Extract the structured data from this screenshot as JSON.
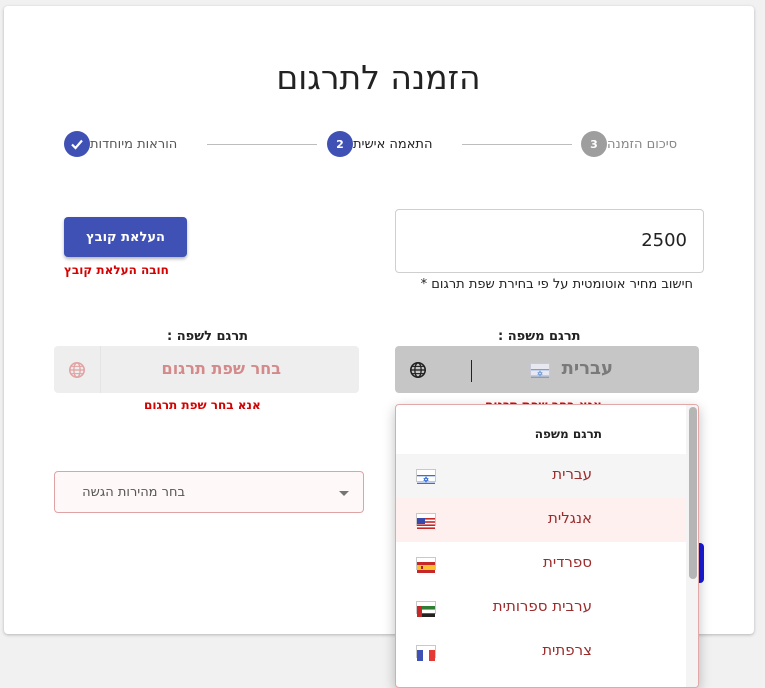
{
  "title": "הזמנה לתרגום",
  "stepper": {
    "steps": [
      {
        "label": "הוראות מיוחדות",
        "number": "",
        "state": "done"
      },
      {
        "label": "התאמה אישית",
        "number": "2",
        "state": "active"
      },
      {
        "label": "סיכום הזמנה",
        "number": "3",
        "state": "inactive"
      }
    ]
  },
  "price": {
    "value": "2500",
    "note": "חישוב מחיר אוטומטית על פי בחירת שפת תרגום *"
  },
  "upload": {
    "button_label": "העלאת קובץ",
    "error": "חובה העלאת קובץ"
  },
  "translate_from": {
    "label": "תרגם משפה :",
    "value": "עברית",
    "error_partial": "אנא בחר שפת תרגום"
  },
  "translate_to": {
    "label": "תרגם לשפה :",
    "placeholder": "בחר שפת תרגום",
    "error": "אנא בחר שפת תרגום"
  },
  "delivery_speed": {
    "placeholder": "בחר מהירות הגשה"
  },
  "dropdown": {
    "header": "תרגם משפה",
    "options": [
      {
        "label": "עברית",
        "flag": "israel-flag-icon"
      },
      {
        "label": "אנגלית",
        "flag": "usa-flag-icon"
      },
      {
        "label": "ספרדית",
        "flag": "spain-flag-icon"
      },
      {
        "label": "ערבית ספרותית",
        "flag": "uae-flag-icon"
      },
      {
        "label": "צרפתית",
        "flag": "france-flag-icon"
      }
    ]
  },
  "colors": {
    "primary": "#3f51b5",
    "completed": "#3f51b5",
    "inactive_step": "#9e9e9e",
    "error": "#d50000",
    "option_text": "#9b2c2c"
  }
}
